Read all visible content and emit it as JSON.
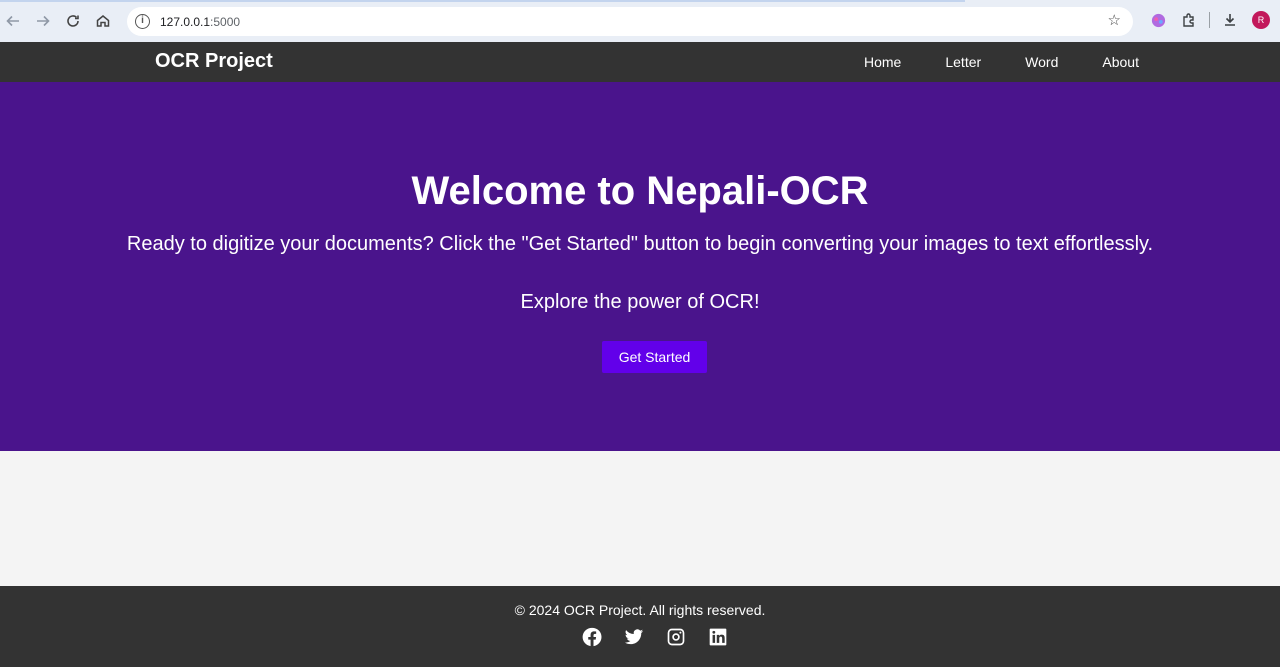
{
  "browser": {
    "url_host": "127.0.0.1",
    "url_port": ":5000",
    "profile_initial": "R"
  },
  "navbar": {
    "brand": "OCR Project",
    "links": [
      "Home",
      "Letter",
      "Word",
      "About"
    ]
  },
  "hero": {
    "title": "Welcome to Nepali-OCR",
    "lead": "Ready to digitize your documents? Click the \"Get Started\" button to begin converting your images to text effortlessly.",
    "sub": "Explore the power of OCR!",
    "cta_label": "Get Started"
  },
  "footer": {
    "copyright": "© 2024 OCR Project. All rights reserved.",
    "socials": [
      "facebook-icon",
      "twitter-icon",
      "instagram-icon",
      "linkedin-icon"
    ]
  },
  "colors": {
    "navbar": "#333333",
    "hero_bg": "#4a148c",
    "cta_bg": "#6200ea",
    "page_bg": "#f4f4f4"
  }
}
